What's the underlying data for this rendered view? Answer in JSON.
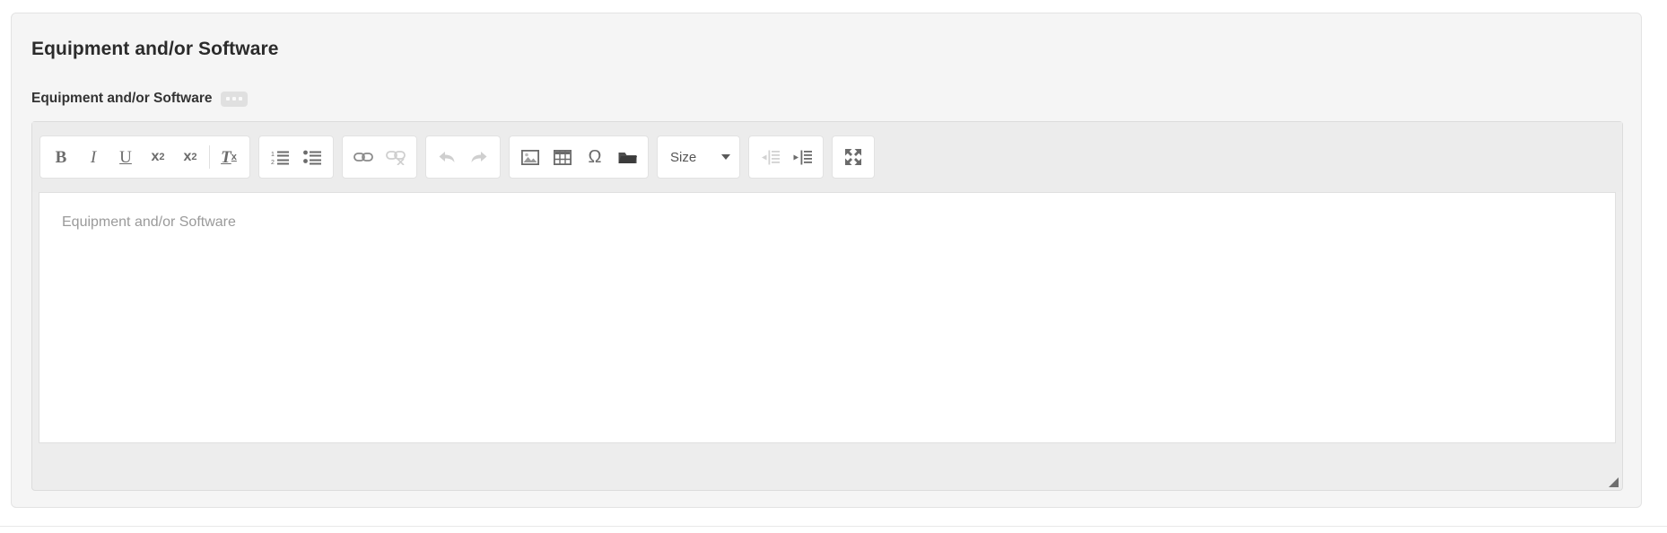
{
  "panel": {
    "title": "Equipment and/or Software"
  },
  "field": {
    "label": "Equipment and/or Software",
    "badge_icon": "ellipsis-badge"
  },
  "editor": {
    "placeholder": "Equipment and/or Software",
    "content": "",
    "resize_handle": "resize-grip-icon",
    "toolbar": {
      "groups": [
        {
          "name": "basic-styles",
          "items": [
            {
              "name": "bold-button",
              "label": "B",
              "icon": "bold-icon",
              "disabled": false
            },
            {
              "name": "italic-button",
              "label": "I",
              "icon": "italic-icon",
              "disabled": false
            },
            {
              "name": "underline-button",
              "label": "U",
              "icon": "underline-icon",
              "disabled": false
            },
            {
              "name": "subscript-button",
              "label": "x2",
              "icon": "subscript-icon",
              "disabled": false
            },
            {
              "name": "superscript-button",
              "label": "x2",
              "icon": "superscript-icon",
              "disabled": false
            },
            {
              "name": "remove-format-button",
              "label": "Tx",
              "icon": "remove-format-icon",
              "disabled": false
            }
          ]
        },
        {
          "name": "lists",
          "items": [
            {
              "name": "numbered-list-button",
              "label": "",
              "icon": "numbered-list-icon",
              "disabled": false
            },
            {
              "name": "bulleted-list-button",
              "label": "",
              "icon": "bulleted-list-icon",
              "disabled": false
            }
          ]
        },
        {
          "name": "links",
          "items": [
            {
              "name": "link-button",
              "label": "",
              "icon": "link-icon",
              "disabled": false
            },
            {
              "name": "unlink-button",
              "label": "",
              "icon": "unlink-icon",
              "disabled": true
            }
          ]
        },
        {
          "name": "history",
          "items": [
            {
              "name": "undo-button",
              "label": "",
              "icon": "undo-arrow-icon",
              "disabled": true
            },
            {
              "name": "redo-button",
              "label": "",
              "icon": "redo-arrow-icon",
              "disabled": true
            }
          ]
        },
        {
          "name": "insert",
          "items": [
            {
              "name": "insert-image-button",
              "label": "",
              "icon": "image-icon",
              "disabled": false
            },
            {
              "name": "insert-table-button",
              "label": "",
              "icon": "table-icon",
              "disabled": false
            },
            {
              "name": "special-character-button",
              "label": "Ω",
              "icon": "omega-icon",
              "disabled": false
            },
            {
              "name": "browse-files-button",
              "label": "",
              "icon": "folder-icon",
              "disabled": false
            }
          ]
        },
        {
          "name": "size",
          "items": [
            {
              "name": "font-size-dropdown",
              "label": "Size",
              "icon": "chevron-down-icon",
              "disabled": false
            }
          ]
        },
        {
          "name": "indent",
          "items": [
            {
              "name": "outdent-button",
              "label": "",
              "icon": "outdent-icon",
              "disabled": true
            },
            {
              "name": "indent-button",
              "label": "",
              "icon": "indent-icon",
              "disabled": false
            }
          ]
        },
        {
          "name": "view",
          "items": [
            {
              "name": "maximize-button",
              "label": "",
              "icon": "maximize-icon",
              "disabled": false
            }
          ]
        }
      ]
    }
  },
  "colors": {
    "page_background": "#ffffff",
    "panel_background": "#f5f5f5",
    "panel_border": "#e3e3e3",
    "toolbar_background": "#ececec",
    "button_background": "#ffffff",
    "icon": "#6b6b6b",
    "icon_disabled": "#cccccc",
    "title_text": "#2b2b2b",
    "label_text": "#333333",
    "placeholder_text": "#9a9a9a",
    "badge_background": "#e0e0e0"
  }
}
